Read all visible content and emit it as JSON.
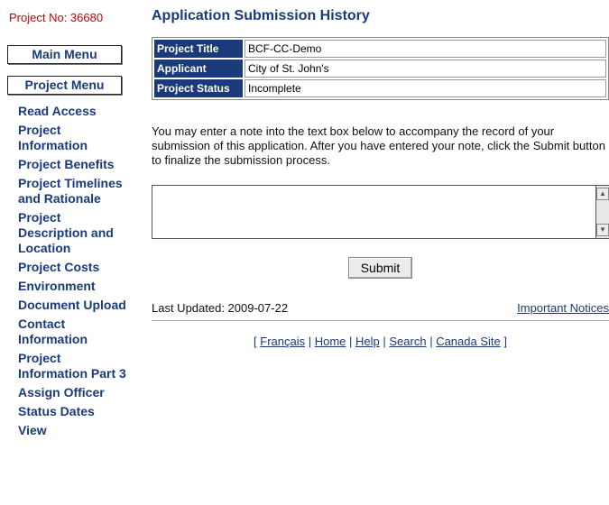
{
  "header": {
    "project_no": "Project No: 36680",
    "title": "Application Submission History"
  },
  "menus": {
    "main": "Main Menu",
    "project": "Project Menu"
  },
  "nav": [
    "Read Access",
    "Project Information",
    "Project Benefits",
    "Project Timelines and Rationale",
    "Project Description and Location",
    "Project Costs",
    "Environment",
    "Document Upload",
    "Contact Information",
    "Project Information Part 3",
    "Assign Officer",
    "Status Dates",
    "View"
  ],
  "project_info": [
    {
      "label": "Project Title",
      "value": "BCF-CC-Demo"
    },
    {
      "label": "Applicant",
      "value": "City of St. John's"
    },
    {
      "label": "Project Status",
      "value": "Incomplete"
    }
  ],
  "instructions": "You may enter a note into the text box below to accompany the record of your submission of this application. After you have entered your note, click the Submit button to finalize the submission process.",
  "note": {
    "value": ""
  },
  "submit_label": "Submit",
  "last_updated": "Last Updated: 2009-07-22",
  "important_notices": "Important Notices",
  "footer": {
    "open": "[ ",
    "sep": " | ",
    "close": " ]",
    "links": [
      "Français",
      "Home",
      "Help",
      "Search",
      "Canada Site"
    ]
  }
}
